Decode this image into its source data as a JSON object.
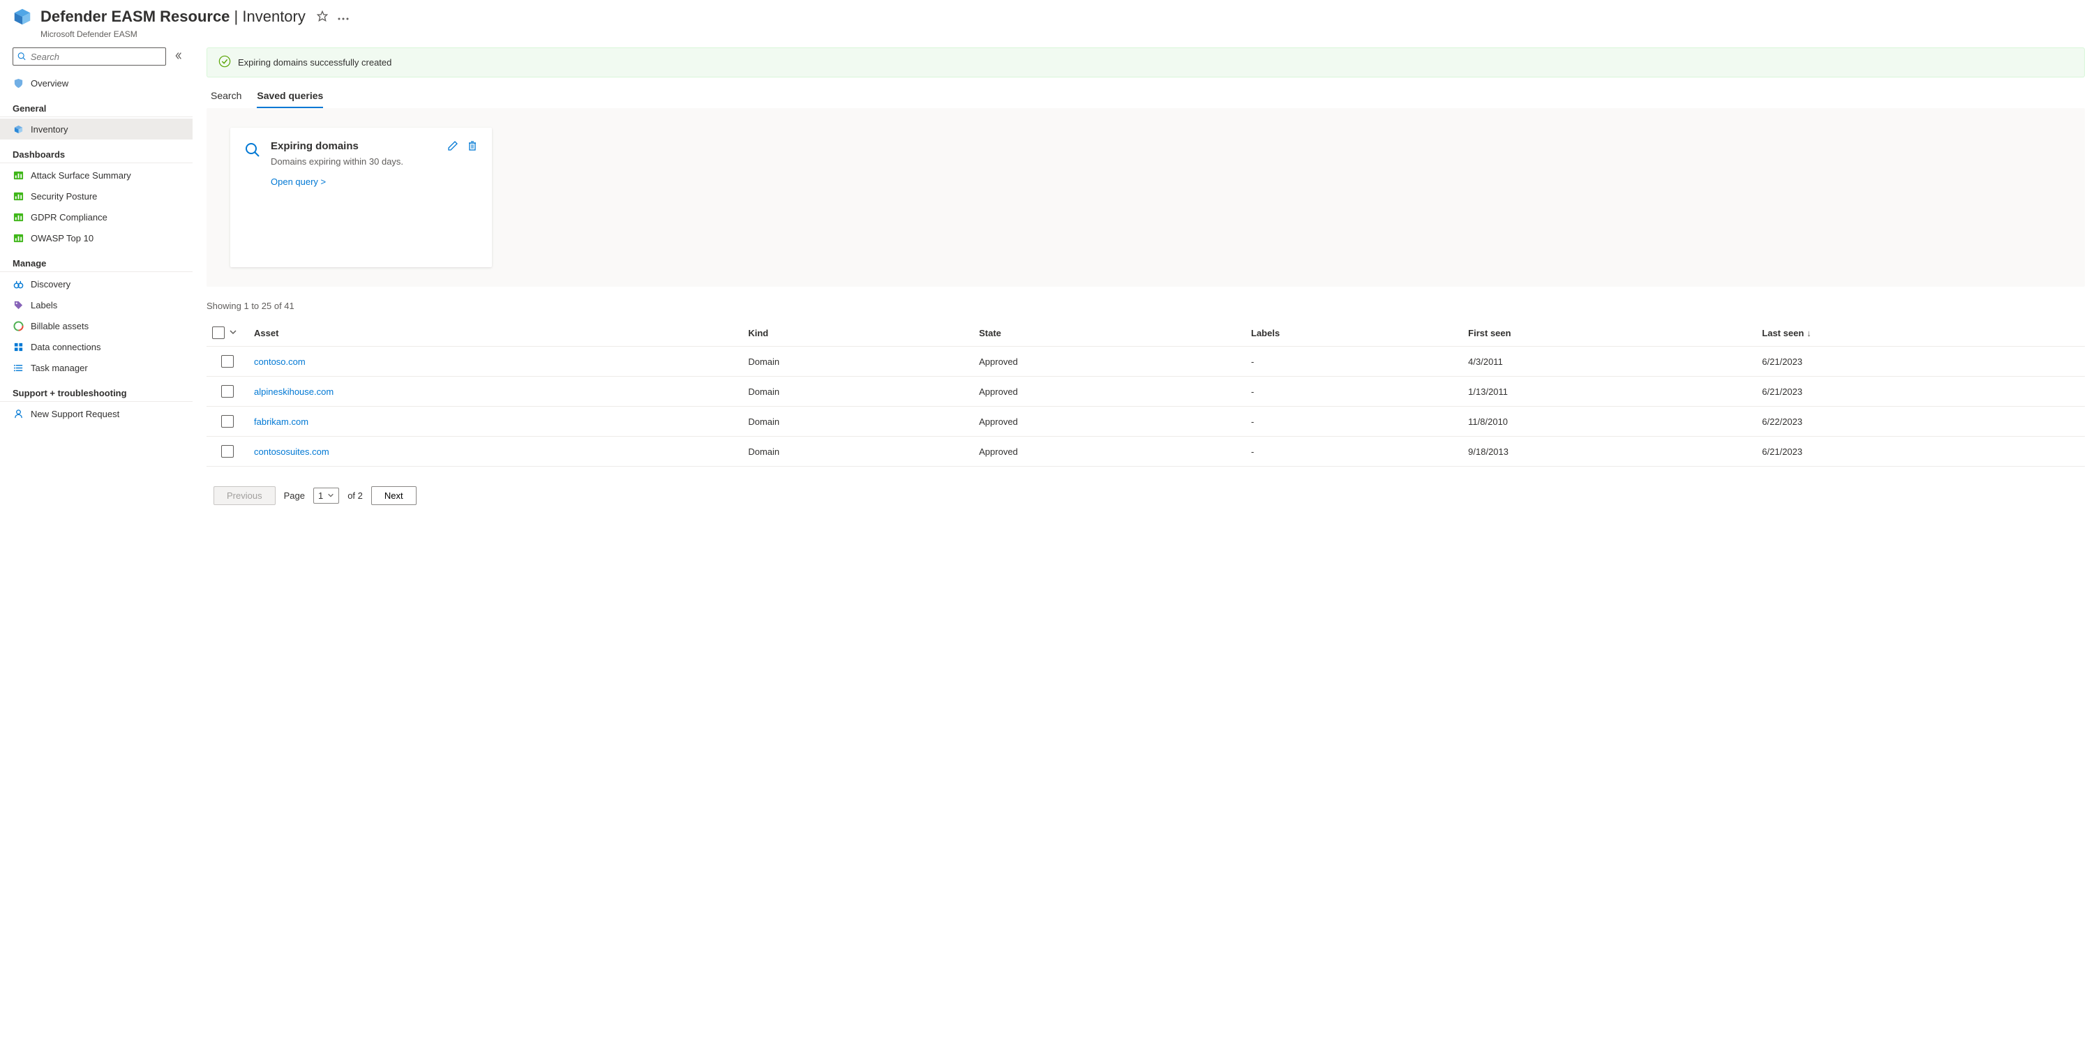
{
  "header": {
    "title_bold": "Defender EASM Resource",
    "title_sep": " | ",
    "title_light": "Inventory",
    "subtitle": "Microsoft Defender EASM"
  },
  "sidebar": {
    "search_placeholder": "Search",
    "overview_label": "Overview",
    "sections": {
      "general": {
        "title": "General",
        "items": [
          {
            "label": "Inventory",
            "active": true
          }
        ]
      },
      "dashboards": {
        "title": "Dashboards",
        "items": [
          {
            "label": "Attack Surface Summary"
          },
          {
            "label": "Security Posture"
          },
          {
            "label": "GDPR Compliance"
          },
          {
            "label": "OWASP Top 10"
          }
        ]
      },
      "manage": {
        "title": "Manage",
        "items": [
          {
            "label": "Discovery"
          },
          {
            "label": "Labels"
          },
          {
            "label": "Billable assets"
          },
          {
            "label": "Data connections"
          },
          {
            "label": "Task manager"
          }
        ]
      },
      "support": {
        "title": "Support + troubleshooting",
        "items": [
          {
            "label": "New Support Request"
          }
        ]
      }
    }
  },
  "notification": {
    "text": "Expiring domains successfully created"
  },
  "tabs": {
    "search": "Search",
    "saved": "Saved queries"
  },
  "query_card": {
    "title": "Expiring domains",
    "description": "Domains expiring within 30 days.",
    "open_link": "Open query >"
  },
  "table": {
    "showing": "Showing 1 to 25 of 41",
    "columns": {
      "asset": "Asset",
      "kind": "Kind",
      "state": "State",
      "labels": "Labels",
      "first_seen": "First seen",
      "last_seen": "Last seen"
    },
    "rows": [
      {
        "asset": "contoso.com",
        "kind": "Domain",
        "state": "Approved",
        "labels": "-",
        "first_seen": "4/3/2011",
        "last_seen": "6/21/2023"
      },
      {
        "asset": "alpineskihouse.com",
        "kind": "Domain",
        "state": "Approved",
        "labels": "-",
        "first_seen": "1/13/2011",
        "last_seen": "6/21/2023"
      },
      {
        "asset": "fabrikam.com",
        "kind": "Domain",
        "state": "Approved",
        "labels": "-",
        "first_seen": "11/8/2010",
        "last_seen": "6/22/2023"
      },
      {
        "asset": "contososuites.com",
        "kind": "Domain",
        "state": "Approved",
        "labels": "-",
        "first_seen": "9/18/2013",
        "last_seen": "6/21/2023"
      }
    ]
  },
  "pagination": {
    "previous": "Previous",
    "next": "Next",
    "page_label": "Page",
    "current": "1",
    "total_text": "of 2"
  }
}
